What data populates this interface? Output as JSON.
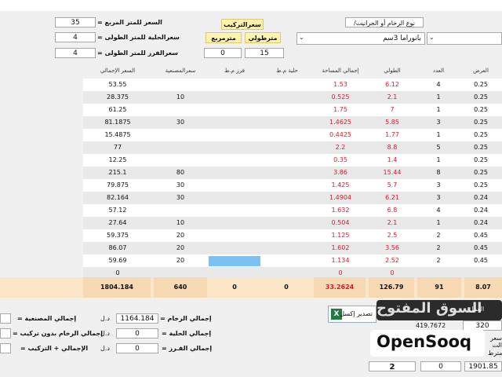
{
  "prices": {
    "tile_m2_label": "السعر للمتر المربع =",
    "tile_m2_value": "35",
    "edge_m_label": "سعرالحلية للمتر الطولى =",
    "edge_m_value": "4",
    "groove_m_label": "سعرالفرز للمتر الطولى =",
    "groove_m_value": "4",
    "install_label": "سعرالتركيب",
    "per_m2_label": "مترمربع",
    "per_m_label": "مترطولي",
    "per_m2_value": "0",
    "per_m_value": "15",
    "type_label": "نوع الرخام أو الجرانيت/",
    "type_value": "بانوراما 3سم"
  },
  "columns": [
    "العرض",
    "العدد",
    "الطولي",
    "إجمالي المساحة",
    "حلية م.ط",
    "فرز م.ط",
    "سعرالمصنعية",
    "السعر الإجمالي"
  ],
  "rows": [
    {
      "w": "0.25",
      "n": "4",
      "len": "6.12",
      "area": "1.53",
      "labor": "",
      "total": "53.55"
    },
    {
      "w": "0.25",
      "n": "1",
      "len": "2.1",
      "area": "0.525",
      "labor": "10",
      "total": "28.375"
    },
    {
      "w": "0.25",
      "n": "1",
      "len": "7",
      "area": "1.75",
      "labor": "",
      "total": "61.25"
    },
    {
      "w": "0.25",
      "n": "3",
      "len": "5.85",
      "area": "1.4625",
      "labor": "30",
      "total": "81.1875"
    },
    {
      "w": "0.25",
      "n": "1",
      "len": "1.77",
      "area": "0.4425",
      "labor": "",
      "total": "15.4875"
    },
    {
      "w": "0.25",
      "n": "5",
      "len": "8.8",
      "area": "2.2",
      "labor": "",
      "total": "77"
    },
    {
      "w": "0.25",
      "n": "1",
      "len": "1.4",
      "area": "0.35",
      "labor": "",
      "total": "12.25"
    },
    {
      "w": "0.25",
      "n": "8",
      "len": "15.44",
      "area": "3.86",
      "labor": "80",
      "total": "215.1"
    },
    {
      "w": "0.25",
      "n": "3",
      "len": "5.7",
      "area": "1.425",
      "labor": "30",
      "total": "79.875"
    },
    {
      "w": "0.24",
      "n": "3",
      "len": "6.21",
      "area": "1.4904",
      "labor": "30",
      "total": "82.164"
    },
    {
      "w": "0.24",
      "n": "4",
      "len": "6.8",
      "area": "1.632",
      "labor": "",
      "total": "57.12"
    },
    {
      "w": "0.24",
      "n": "1",
      "len": "2.1",
      "area": "0.504",
      "labor": "10",
      "total": "27.64"
    },
    {
      "w": "0.45",
      "n": "2",
      "len": "2.5",
      "area": "1.125",
      "labor": "20",
      "total": "59.375"
    },
    {
      "w": "0.45",
      "n": "2",
      "len": "3.56",
      "area": "1.602",
      "labor": "20",
      "total": "86.07"
    },
    {
      "w": "0.45",
      "n": "2",
      "len": "2.52",
      "area": "1.134",
      "labor": "20",
      "total": "59.69"
    },
    {
      "w": "",
      "n": "",
      "len": "0",
      "area": "0",
      "labor": "",
      "total": "0"
    }
  ],
  "totals": {
    "width": "8.07",
    "count": "91",
    "length": "126.79",
    "area": "33.2624",
    "edge": "0",
    "groove": "0",
    "labor": "640",
    "total": "1804.184"
  },
  "summary": {
    "labor_label": "إجمالي المصنعية =",
    "tile_label": "إجمالي الرخام =",
    "tile_value": "1164.184",
    "edge_label": "إجمالي الحلية =",
    "edge_value": "0",
    "groove_label": "إجمالي الفـرز =",
    "groove_value": "0",
    "tile_noinst_label": "إجمالي الرخام بدون تركيب =",
    "total_inst_label": "الإجمالي + التركيب =",
    "currency": "د.ل",
    "excel_label": "تصدير إكسل",
    "right_num1": "419.7672",
    "right_num2": "320",
    "right_small_label": "العمل",
    "right_lbl2": "سعر الت",
    "right_lbl3": "مترط",
    "bottom_a": "2",
    "bottom_b": "0",
    "bottom_c": "1901.85",
    "watermark": "السوق المفتوح",
    "logo": "OpenSooq"
  }
}
